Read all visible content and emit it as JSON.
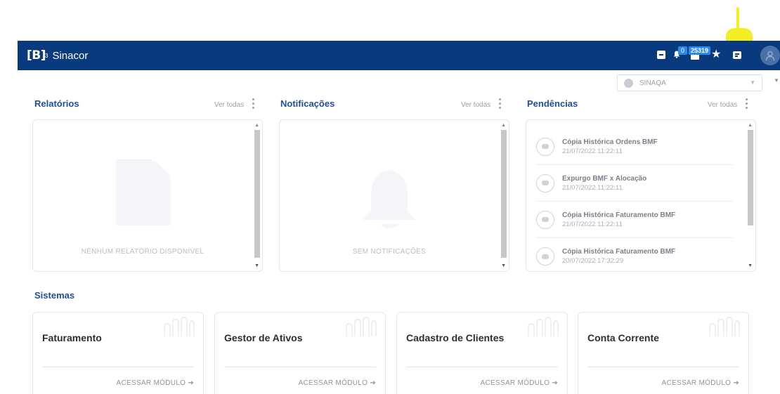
{
  "app": {
    "brand": "[B]",
    "brand_sup": "3",
    "name": "Sinacor"
  },
  "header": {
    "notifications_badge": "0",
    "messages_badge": "25319",
    "icons": [
      "archive-icon",
      "bell-icon",
      "message-icon",
      "star-icon",
      "chat-icon",
      "user-avatar-icon"
    ]
  },
  "environment": {
    "selected": "SINAQA"
  },
  "panels": {
    "relatorios": {
      "title": "Relatórios",
      "see_all": "Ver todas",
      "empty": "NENHUM RELATÓRIO DISPONÍVEL"
    },
    "notificacoes": {
      "title": "Notificações",
      "see_all": "Ver todas",
      "empty": "SEM NOTIFICAÇÕES"
    },
    "pendencias": {
      "title": "Pendências",
      "see_all": "Ver todas",
      "items": [
        {
          "title": "Cópia Histórica Ordens BMF",
          "date": "21/07/2022 11:22:11"
        },
        {
          "title": "Expurgo BMF x Alocação",
          "date": "21/07/2022 11:22:11"
        },
        {
          "title": "Cópia Histórica Faturamento BMF",
          "date": "21/07/2022 11:22:11"
        },
        {
          "title": "Cópia Histórica Faturamento BMF",
          "date": "20/07/2022 17:32:29"
        }
      ]
    }
  },
  "sistemas": {
    "title": "Sistemas",
    "cards": [
      {
        "name": "Faturamento",
        "action": "ACESSAR MÓDULO"
      },
      {
        "name": "Gestor de Ativos",
        "action": "ACESSAR MÓDULO"
      },
      {
        "name": "Cadastro de Clientes",
        "action": "ACESSAR MÓDULO"
      },
      {
        "name": "Conta Corrente",
        "action": "ACESSAR MÓDULO"
      }
    ]
  },
  "colors": {
    "header_bg": "#0a3a7e",
    "accent": "#1d4f9a",
    "badge": "#2d8be6",
    "annotation": "#f2ec1a"
  }
}
